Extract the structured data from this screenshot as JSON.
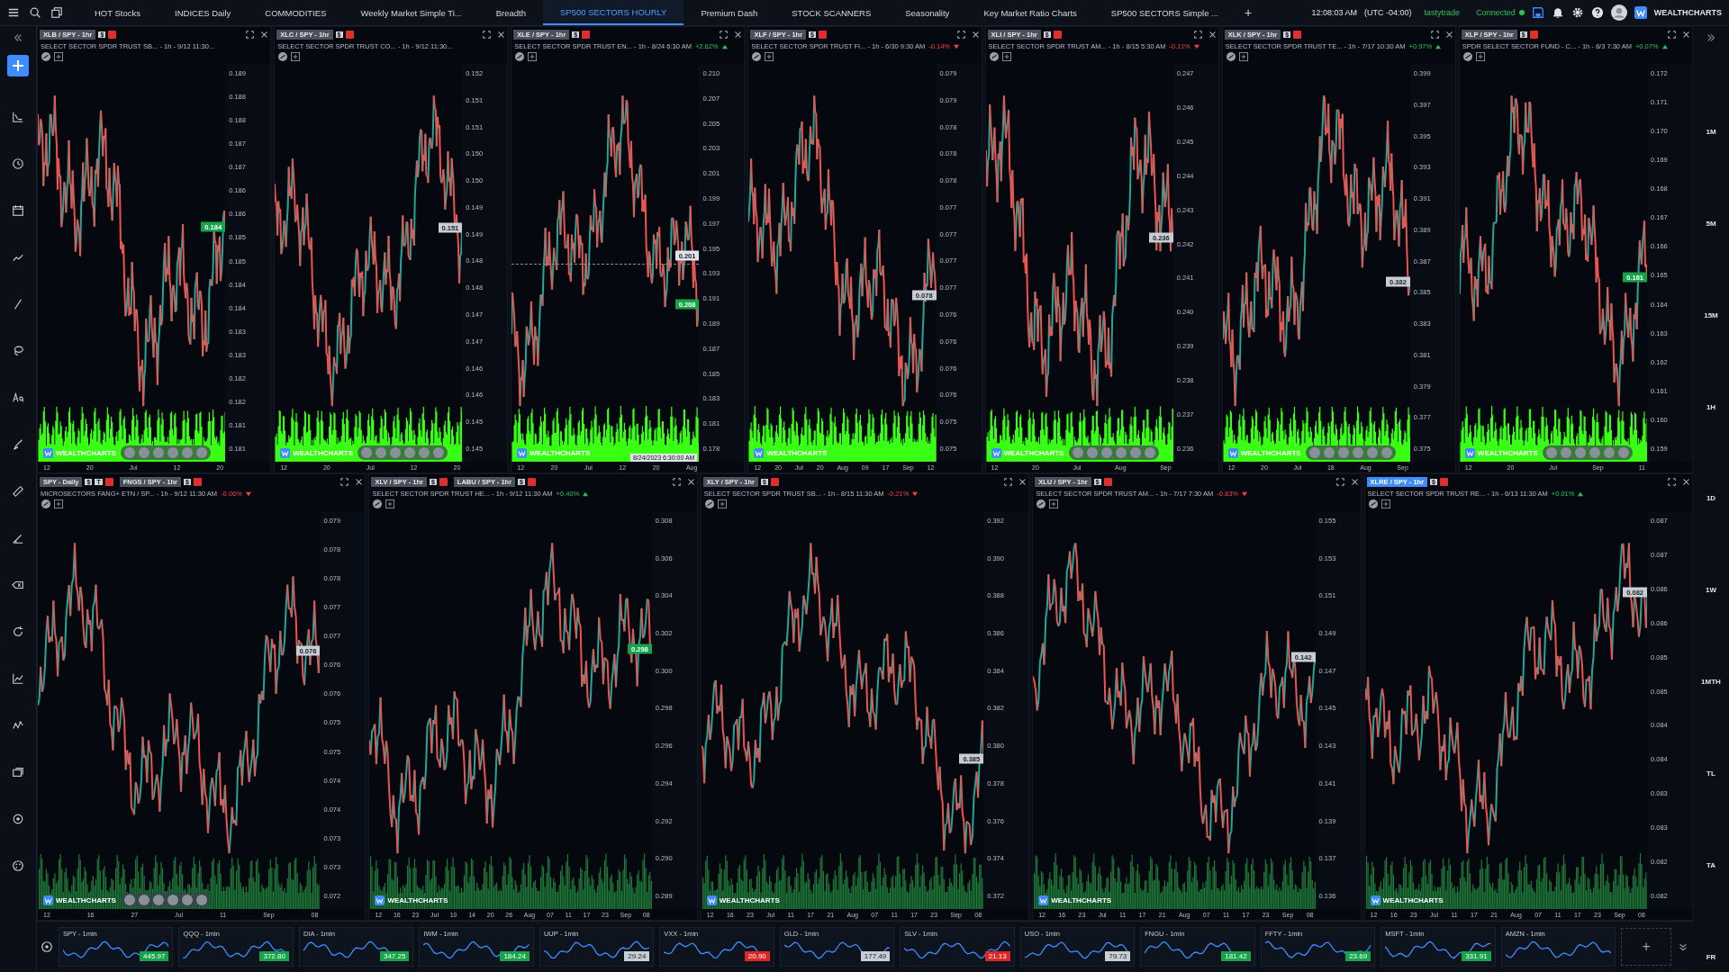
{
  "top_tabs": [
    {
      "label": "HOT Stocks",
      "selected": false
    },
    {
      "label": "INDICES Daily",
      "selected": false
    },
    {
      "label": "COMMODITIES",
      "selected": false
    },
    {
      "label": "Weekly Market Simple Ti...",
      "selected": false
    },
    {
      "label": "Breadth",
      "selected": false
    },
    {
      "label": "SP500 SECTORS HOURLY",
      "selected": true
    },
    {
      "label": "Premium Dash",
      "selected": false
    },
    {
      "label": "STOCK SCANNERS",
      "selected": false
    },
    {
      "label": "Seasonality",
      "selected": false
    },
    {
      "label": "Key Market Ratio Charts",
      "selected": false
    },
    {
      "label": "SP500 SECTORS Simple ...",
      "selected": false
    }
  ],
  "add_tab": "+",
  "clock": "12:08:03 AM",
  "timezone": "(UTC -04:00)",
  "broker": "tastytrade",
  "connection": {
    "label": "Connected",
    "on": true
  },
  "brand": "WEALTHCHARTS",
  "timeframes": [
    "1M",
    "5M",
    "15M",
    "1H",
    "1D",
    "1W",
    "1MTH",
    "TL",
    "TA",
    "FR"
  ],
  "rows": [
    {
      "kind": "top",
      "panels": [
        {
          "tabs": [
            {
              "label": "XLB / SPY - 1hr",
              "selected": false,
              "tags": [
                "$"
              ]
            }
          ],
          "description": "SELECT SECTOR SPDR TRUST SB... - 1h - 9/12 11:30...",
          "yticks": [
            "0.189",
            "0.188",
            "0.188",
            "0.187",
            "0.187",
            "0.186",
            "0.186",
            "0.185",
            "0.185",
            "0.184",
            "0.184",
            "0.183",
            "0.183",
            "0.182",
            "0.182",
            "0.181",
            "0.181"
          ],
          "xticks": [
            "12",
            "20",
            "Jul",
            "12",
            "20"
          ],
          "badge": {
            "text": "0.184",
            "kind": "up"
          },
          "nav_controls": true,
          "watermark": "WEALTHCHARTS"
        },
        {
          "tabs": [
            {
              "label": "XLC / SPY - 1hr",
              "selected": false,
              "tags": [
                "$"
              ]
            }
          ],
          "description": "SELECT SECTOR SPDR TRUST CO... - 1h - 9/12 11:30...",
          "yticks": [
            "0.152",
            "0.151",
            "0.151",
            "0.150",
            "0.150",
            "0.149",
            "0.149",
            "0.148",
            "0.148",
            "0.147",
            "0.147",
            "0.146",
            "0.146",
            "0.145",
            "0.145"
          ],
          "xticks": [
            "12",
            "20",
            "Jul",
            "12",
            "20"
          ],
          "badge": {
            "text": "0.151",
            "kind": "neutral"
          },
          "nav_controls": true,
          "watermark": "WEALTHCHARTS"
        },
        {
          "tabs": [
            {
              "label": "XLE / SPY - 1hr",
              "selected": false,
              "tags": [
                "$"
              ]
            }
          ],
          "description": "SELECT SECTOR SPDR TRUST EN... - 1h - 8/24 6:30 AM",
          "change": {
            "text": "+2.62%",
            "positive": true
          },
          "yticks": [
            "0.210",
            "0.207",
            "0.205",
            "0.203",
            "0.201",
            "0.199",
            "0.197",
            "0.195",
            "0.193",
            "0.191",
            "0.189",
            "0.187",
            "0.185",
            "0.183",
            "0.181",
            "0.178"
          ],
          "xticks": [
            "12",
            "20",
            "Jul",
            "12",
            "20",
            "Aug"
          ],
          "crosshair": {
            "price": "0.201",
            "date": "8/24/2023 6:30:00 AM"
          },
          "badge": {
            "text": "0.208",
            "kind": "up"
          },
          "nav_controls": false,
          "watermark": "WEALTHCHARTS"
        },
        {
          "tabs": [
            {
              "label": "XLF / SPY - 1hr",
              "selected": false,
              "tags": [
                "$"
              ]
            }
          ],
          "description": "SELECT SECTOR SPDR TRUST FI... - 1h - 6/30 9:30 AM",
          "change": {
            "text": "-0.14%",
            "positive": false
          },
          "yticks": [
            "0.079",
            "0.079",
            "0.078",
            "0.078",
            "0.078",
            "0.077",
            "0.077",
            "0.077",
            "0.077",
            "0.076",
            "0.076",
            "0.076",
            "0.076",
            "0.075",
            "0.075"
          ],
          "xticks": [
            "12",
            "20",
            "Jul",
            "20",
            "Aug",
            "09",
            "17",
            "Sep",
            "12"
          ],
          "badge": {
            "text": "0.078",
            "kind": "neutral"
          },
          "nav_controls": false,
          "watermark": "WEALTHCHARTS"
        },
        {
          "tabs": [
            {
              "label": "XLI / SPY - 1hr",
              "selected": false,
              "tags": [
                "$"
              ]
            }
          ],
          "description": "SELECT SECTOR SPDR TRUST AM... - 1h - 8/15 5:30 AM",
          "change": {
            "text": "-0.11%",
            "positive": false
          },
          "yticks": [
            "0.247",
            "0.246",
            "0.245",
            "0.244",
            "0.243",
            "0.242",
            "0.241",
            "0.240",
            "0.239",
            "0.238",
            "0.237",
            "0.236"
          ],
          "xticks": [
            "12",
            "20",
            "Jul",
            "Aug",
            "Sep"
          ],
          "badge": {
            "text": "0.236",
            "kind": "neutral"
          },
          "nav_controls": true,
          "watermark": "WEALTHCHARTS"
        },
        {
          "tabs": [
            {
              "label": "XLK / SPY - 1hr",
              "selected": false,
              "tags": [
                "$"
              ]
            }
          ],
          "description": "SELECT SECTOR SPDR TRUST TE... - 1h - 7/17 10:30 AM",
          "change": {
            "text": "+0.97%",
            "positive": true
          },
          "yticks": [
            "0.399",
            "0.397",
            "0.395",
            "0.393",
            "0.391",
            "0.389",
            "0.387",
            "0.385",
            "0.383",
            "0.381",
            "0.379",
            "0.377",
            "0.375"
          ],
          "xticks": [
            "12",
            "20",
            "Jul",
            "18",
            "Aug",
            "Sep"
          ],
          "badge": {
            "text": "0.382",
            "kind": "neutral"
          },
          "nav_controls": true,
          "watermark": "WEALTHCHARTS"
        },
        {
          "tabs": [
            {
              "label": "XLP / SPY - 1hr",
              "selected": false,
              "tags": [
                "$"
              ]
            }
          ],
          "description": "SPDR SELECT SECTOR FUND - C... - 1h - 8/3 7:30 AM",
          "change": {
            "text": "+0.07%",
            "positive": true
          },
          "yticks": [
            "0.172",
            "0.171",
            "0.170",
            "0.169",
            "0.168",
            "0.167",
            "0.166",
            "0.165",
            "0.164",
            "0.163",
            "0.162",
            "0.161",
            "0.160",
            "0.159"
          ],
          "xticks": [
            "12",
            "20",
            "Jul",
            "Sep",
            "11"
          ],
          "badge": {
            "text": "0.161",
            "kind": "up"
          },
          "nav_controls": true,
          "watermark": "WEALTHCHARTS"
        }
      ]
    },
    {
      "kind": "bottom",
      "panels": [
        {
          "tabs": [
            {
              "label": "SPY - Daily",
              "selected": false,
              "tags": [
                "$",
                "T"
              ]
            },
            {
              "label": "FNGS / SPY - 1hr",
              "selected": false,
              "tags": [
                "$"
              ]
            }
          ],
          "description": "MICROSECTORS FANG+ ETN / SP... - 1h - 9/12 11:30 AM",
          "change": {
            "text": "-0.06%",
            "positive": false
          },
          "yticks": [
            "0.079",
            "0.078",
            "0.078",
            "0.077",
            "0.077",
            "0.076",
            "0.076",
            "0.075",
            "0.075",
            "0.074",
            "0.074",
            "0.073",
            "0.073",
            "0.072"
          ],
          "xticks": [
            "12",
            "16",
            "27",
            "Jul",
            "11",
            "Sep",
            "08"
          ],
          "badge": {
            "text": "0.076",
            "kind": "neutral"
          },
          "nav_controls": true,
          "watermark": "WEALTHCHARTS"
        },
        {
          "tabs": [
            {
              "label": "XLV / SPY - 1hr",
              "selected": false,
              "tags": [
                "$"
              ]
            },
            {
              "label": "LABU / SPY - 1hr",
              "selected": false,
              "tags": [
                "$"
              ]
            }
          ],
          "description": "SELECT SECTOR SPDR TRUST HE... - 1h - 9/12 11:30 AM",
          "change": {
            "text": "+0.40%",
            "positive": true
          },
          "yticks": [
            "0.308",
            "0.306",
            "0.304",
            "0.302",
            "0.300",
            "0.298",
            "0.296",
            "0.294",
            "0.292",
            "0.290",
            "0.289"
          ],
          "xticks": [
            "12",
            "16",
            "23",
            "Jul",
            "10",
            "14",
            "20",
            "26",
            "Aug",
            "07",
            "11",
            "17",
            "23",
            "Sep",
            "08"
          ],
          "badge": {
            "text": "0.298",
            "kind": "up"
          },
          "nav_controls": false,
          "watermark": "WEALTHCHARTS"
        },
        {
          "tabs": [
            {
              "label": "XLY / SPY - 1hr",
              "selected": false,
              "tags": [
                "$"
              ]
            }
          ],
          "description": "SELECT SECTOR SPDR TRUST SB... - 1h - 8/15 11:30 AM",
          "change": {
            "text": "-0.21%",
            "positive": false
          },
          "yticks": [
            "0.392",
            "0.390",
            "0.388",
            "0.386",
            "0.384",
            "0.382",
            "0.380",
            "0.378",
            "0.376",
            "0.374",
            "0.372"
          ],
          "xticks": [
            "12",
            "16",
            "23",
            "Jul",
            "11",
            "17",
            "21",
            "Aug",
            "07",
            "11",
            "17",
            "23",
            "Sep",
            "08"
          ],
          "badge": {
            "text": "0.385",
            "kind": "neutral"
          },
          "nav_controls": false,
          "watermark": "WEALTHCHARTS"
        },
        {
          "tabs": [
            {
              "label": "XLU / SPY - 1hr",
              "selected": false,
              "tags": [
                "$"
              ]
            }
          ],
          "description": "SELECT SECTOR SPDR TRUST AM... - 1h - 7/17 7:30 AM",
          "change": {
            "text": "-0.83%",
            "positive": false
          },
          "yticks": [
            "0.155",
            "0.153",
            "0.151",
            "0.149",
            "0.147",
            "0.145",
            "0.143",
            "0.141",
            "0.139",
            "0.137",
            "0.136"
          ],
          "xticks": [
            "12",
            "16",
            "23",
            "Jul",
            "11",
            "17",
            "21",
            "Aug",
            "07",
            "11",
            "17",
            "23",
            "Sep",
            "08"
          ],
          "badge": {
            "text": "0.142",
            "kind": "neutral"
          },
          "nav_controls": false,
          "watermark": "WEALTHCHARTS"
        },
        {
          "tabs": [
            {
              "label": "XLRE / SPY - 1hr",
              "selected": true,
              "tags": [
                "$"
              ]
            }
          ],
          "description": "SELECT SECTOR SPDR TRUST RE... - 1h - 6/13 11:30 AM",
          "change": {
            "text": "+0.01%",
            "positive": true
          },
          "yticks": [
            "0.087",
            "0.087",
            "0.086",
            "0.086",
            "0.085",
            "0.085",
            "0.084",
            "0.084",
            "0.083",
            "0.083",
            "0.082",
            "0.082"
          ],
          "xticks": [
            "12",
            "16",
            "23",
            "Jul",
            "11",
            "17",
            "21",
            "Aug",
            "07",
            "11",
            "17",
            "23",
            "Sep",
            "08"
          ],
          "badge": {
            "text": "0.082",
            "kind": "neutral"
          },
          "nav_controls": false,
          "watermark": "WEALTHCHARTS"
        }
      ]
    }
  ],
  "tickers": [
    {
      "label": "SPY - 1min",
      "price": "445.97",
      "kind": "up"
    },
    {
      "label": "QQQ - 1min",
      "price": "372.80",
      "kind": "up"
    },
    {
      "label": "DIA - 1min",
      "price": "347.25",
      "kind": "up"
    },
    {
      "label": "IWM - 1min",
      "price": "184.24",
      "kind": "up"
    },
    {
      "label": "UUP - 1min",
      "price": "29.24",
      "kind": "neutral"
    },
    {
      "label": "VXX - 1min",
      "price": "20.90",
      "kind": "down"
    },
    {
      "label": "GLD - 1min",
      "price": "177.49",
      "kind": "neutral"
    },
    {
      "label": "SLV - 1min",
      "price": "21.13",
      "kind": "down"
    },
    {
      "label": "USO - 1min",
      "price": "79.73",
      "kind": "neutral"
    },
    {
      "label": "FNGU - 1min",
      "price": "181.42",
      "kind": "up"
    },
    {
      "label": "FFTY - 1min",
      "price": "23.69",
      "kind": "up"
    },
    {
      "label": "MSFT - 1min",
      "price": "331.91",
      "kind": "up"
    },
    {
      "label": "AMZN - 1min"
    }
  ],
  "add_ticker": "+"
}
